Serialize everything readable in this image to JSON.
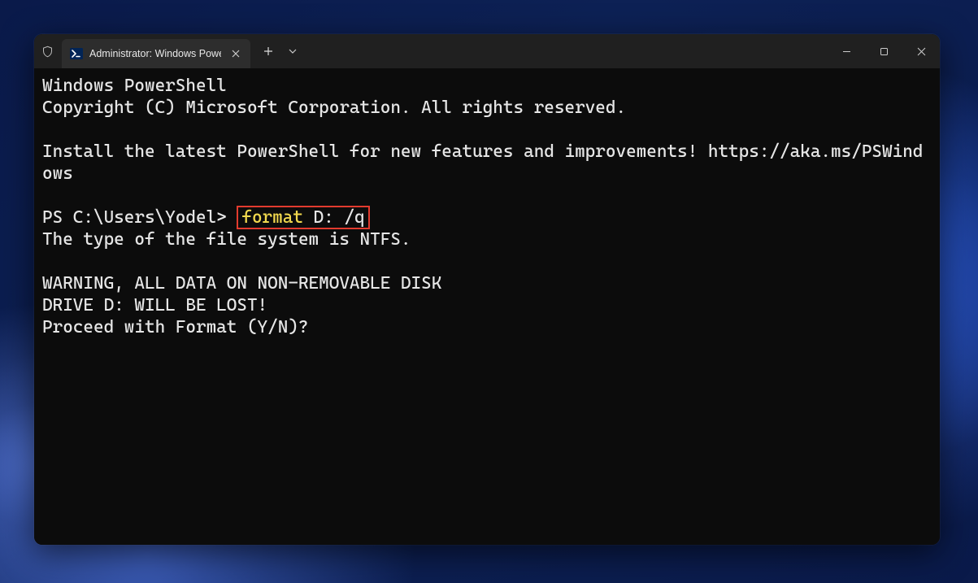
{
  "window": {
    "tab_title": "Administrator: Windows Powe",
    "controls": {
      "minimize": "Minimize",
      "maximize": "Maximize",
      "close": "Close"
    }
  },
  "terminal": {
    "header_line1": "Windows PowerShell",
    "header_line2": "Copyright (C) Microsoft Corporation. All rights reserved.",
    "install_msg": "Install the latest PowerShell for new features and improvements! https://aka.ms/PSWindows",
    "prompt": "PS C:\\Users\\Yodel> ",
    "command_keyword": "format",
    "command_args": " D: /q",
    "fs_line": "The type of the file system is NTFS.",
    "warn_line1": "WARNING, ALL DATA ON NON-REMOVABLE DISK",
    "warn_line2": "DRIVE D: WILL BE LOST!",
    "proceed_line": "Proceed with Format (Y/N)?"
  },
  "colors": {
    "cmd_keyword": "#f2d94e",
    "highlight_border": "#e23b2e",
    "terminal_bg": "#0c0c0c",
    "terminal_fg": "#e6e6e6",
    "titlebar_bg": "#202020",
    "tab_bg": "#2d2d2d"
  }
}
